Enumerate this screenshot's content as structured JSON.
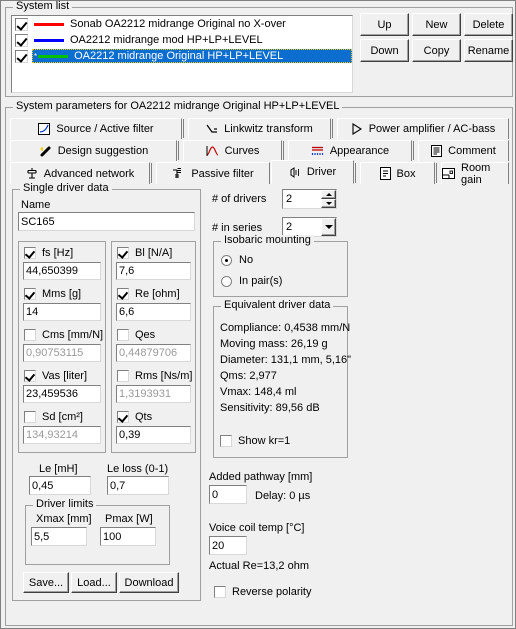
{
  "system_list": {
    "title": "System list",
    "rows": [
      {
        "checked": true,
        "color": "#ff0000",
        "label": "Sonab OA2212 midrange Original no X-over",
        "selected": false
      },
      {
        "checked": true,
        "color": "#0000ff",
        "label": "OA2212 midrange mod HP+LP+LEVEL",
        "selected": false
      },
      {
        "checked": true,
        "color": "#00c000",
        "label": "OA2212 midrange Original HP+LP+LEVEL",
        "selected": true,
        "marker": "*"
      }
    ],
    "buttons": [
      "Up",
      "New",
      "Delete",
      "Down",
      "Copy",
      "Rename"
    ]
  },
  "params": {
    "title": "System parameters for OA2212 midrange Original HP+LP+LEVEL",
    "tabs_row1": [
      {
        "label": "Source / Active filter",
        "icon": "source-icon",
        "active": false
      },
      {
        "label": "Linkwitz transform",
        "icon": "linkwitz-icon",
        "active": false
      },
      {
        "label": "Power amplifier / AC-bass",
        "icon": "amplifier-icon",
        "active": false
      }
    ],
    "tabs_row2": [
      {
        "label": "Design suggestion",
        "icon": "wand-icon",
        "active": false
      },
      {
        "label": "Curves",
        "icon": "curves-icon",
        "active": false
      },
      {
        "label": "Appearance",
        "icon": "appearance-icon",
        "active": false
      },
      {
        "label": "Comment",
        "icon": "comment-icon",
        "active": false
      }
    ],
    "tabs_row3": [
      {
        "label": "Advanced network",
        "icon": "network-icon",
        "active": false
      },
      {
        "label": "Passive filter",
        "icon": "passive-filter-icon",
        "active": false
      },
      {
        "label": "Driver",
        "icon": "driver-icon",
        "active": true
      },
      {
        "label": "Box",
        "icon": "box-icon",
        "active": false
      },
      {
        "label": "Room gain",
        "icon": "room-gain-icon",
        "active": false
      }
    ]
  },
  "single_driver": {
    "title": "Single driver data",
    "name_label": "Name",
    "name_value": "SC165",
    "fields_left": [
      {
        "label": "fs [Hz]",
        "value": "44,650399",
        "checked": true,
        "enabled": true
      },
      {
        "label": "Mms [g]",
        "value": "14",
        "checked": true,
        "enabled": true
      },
      {
        "label": "Cms [mm/N]",
        "value": "0,90753115",
        "checked": false,
        "enabled": false
      },
      {
        "label": "Vas [liter]",
        "value": "23,459536",
        "checked": true,
        "enabled": true
      },
      {
        "label": "Sd [cm²]",
        "value": "134,93214",
        "checked": false,
        "enabled": false
      }
    ],
    "fields_right": [
      {
        "label": "Bl [N/A]",
        "value": "7,6",
        "checked": true,
        "enabled": true
      },
      {
        "label": "Re [ohm]",
        "value": "6,6",
        "checked": true,
        "enabled": true
      },
      {
        "label": "Qes",
        "value": "0,44879706",
        "checked": false,
        "enabled": false
      },
      {
        "label": "Rms [Ns/m]",
        "value": "1,3193931",
        "checked": false,
        "enabled": false
      },
      {
        "label": "Qts",
        "value": "0,39",
        "checked": true,
        "enabled": true
      }
    ],
    "le_label": "Le [mH]",
    "le_value": "0,45",
    "le_loss_label": "Le loss (0-1)",
    "le_loss_value": "0,7",
    "driver_limits": {
      "title": "Driver limits",
      "xmax_label": "Xmax [mm]",
      "xmax_value": "5,5",
      "pmax_label": "Pmax [W]",
      "pmax_value": "100"
    },
    "save_label": "Save...",
    "load_label": "Load...",
    "download_label": "Download"
  },
  "right": {
    "drivers_label": "# of drivers",
    "drivers_value": "2",
    "series_label": "# in series",
    "series_value": "2",
    "isobaric": {
      "title": "Isobaric mounting",
      "option_no": "No",
      "option_pairs": "In pair(s)",
      "selected": "No"
    },
    "equivalent": {
      "title": "Equivalent driver data",
      "lines": [
        "Compliance: 0,4538 mm/N",
        "Moving mass: 26,19 g",
        "Diameter: 131,1 mm, 5,16\"",
        "Qms: 2,977",
        "Vmax: 148,4 ml",
        "Sensitivity: 89,56 dB"
      ],
      "show_kr_label": "Show kr=1",
      "show_kr_checked": false
    },
    "added_pathway_label": "Added pathway [mm]",
    "added_pathway_value": "0",
    "delay_text": "Delay: 0 µs",
    "voice_coil_label": "Voice coil temp [°C]",
    "voice_coil_value": "20",
    "actual_re_text": "Actual Re=13,2 ohm",
    "reverse_polarity_label": "Reverse polarity",
    "reverse_polarity_checked": false
  },
  "colors": {
    "face": "#f0f0f0",
    "selection": "#0a6dd0",
    "focus_dots": "#ffcc00"
  }
}
